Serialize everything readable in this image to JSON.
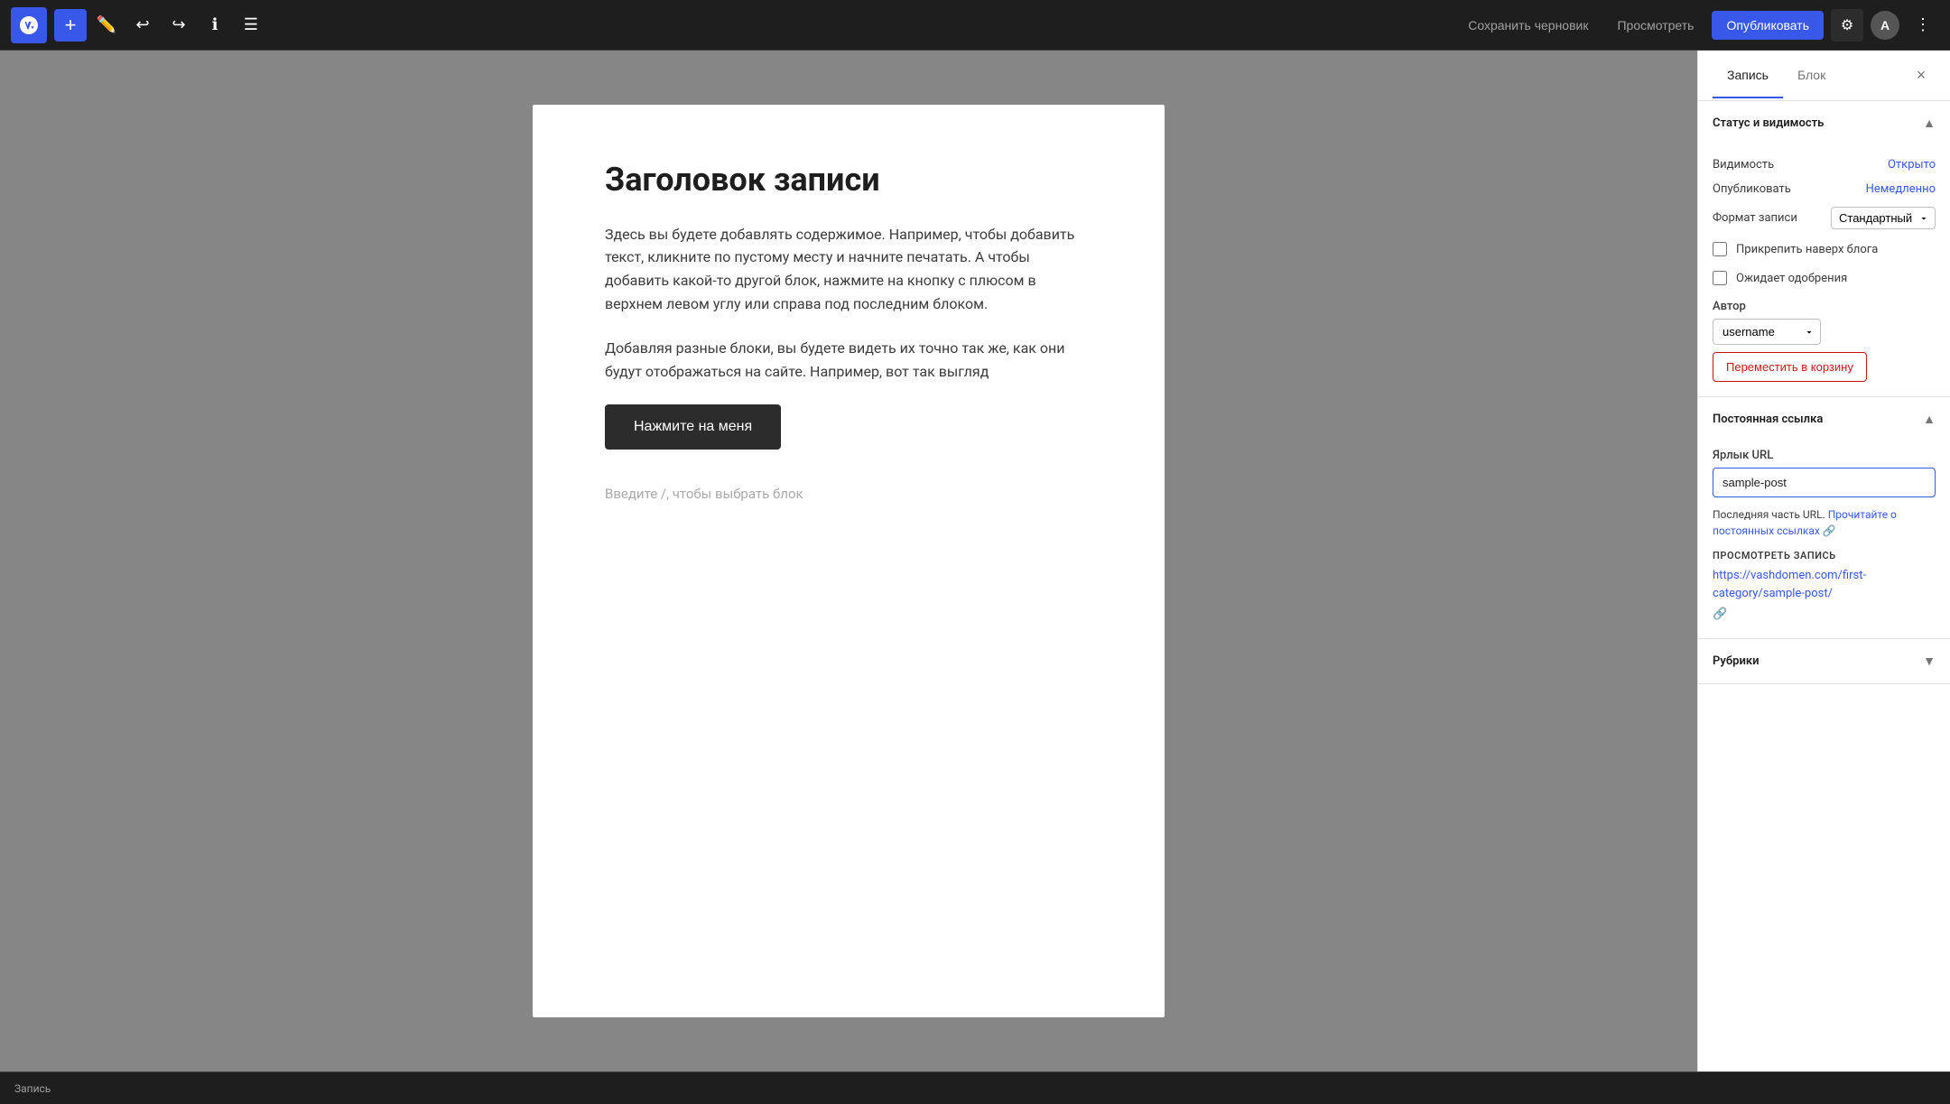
{
  "toolbar": {
    "add_label": "+",
    "save_draft_label": "Сохранить черновик",
    "preview_label": "Просмотреть",
    "publish_label": "Опубликовать"
  },
  "sidebar": {
    "tab_post": "Запись",
    "tab_block": "Блок",
    "close_icon": "×",
    "status_section": {
      "title": "Статус и видимость",
      "visibility_label": "Видимость",
      "visibility_value": "Открыто",
      "publish_label": "Опубликовать",
      "publish_value": "Немедленно",
      "format_label": "Формат записи",
      "format_value": "Стандартный",
      "pin_label": "Прикрепить наверх блога",
      "review_label": "Ожидает одобрения",
      "author_label": "Автор",
      "author_value": "username",
      "trash_label": "Переместить в корзину"
    },
    "permalink_section": {
      "title": "Постоянная ссылка",
      "url_label": "Ярлык URL",
      "url_value": "sample-post",
      "info_text": "Последняя часть URL.",
      "info_link": "Прочитайте о постоянных ссылках",
      "view_label": "ПРОСМОТРЕТЬ ЗАПИСЬ",
      "view_url": "https://vashdomen.com/first-category/sample-post/"
    },
    "rubrics_section": {
      "title": "Рубрики"
    }
  },
  "editor": {
    "title": "Заголовок записи",
    "body_1": "Здесь вы будете добавлять содержимое. Например, чтобы добавить текст, кликните по пустому месту и начните печатать. А чтобы добавить какой-то другой блок, нажмите на кнопку с плюсом в верхнем левом углу или справа под последним блоком.",
    "body_2": "Добавляя разные блоки, вы будете видеть их точно так же, как они будут отображаться на сайте. Например, вот так выгляд",
    "button_label": "Нажмите на меня",
    "placeholder": "Введите /, чтобы выбрать блок"
  },
  "status_bar": {
    "text": "Запись"
  }
}
